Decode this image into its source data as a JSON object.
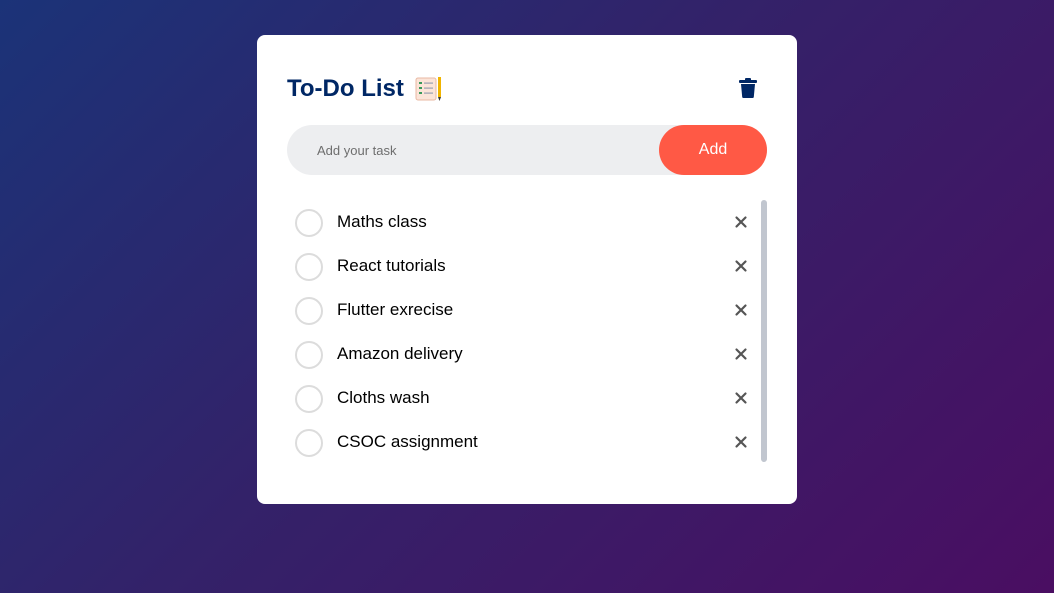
{
  "card": {
    "title": "To-Do List",
    "title_icon": "notepad-icon",
    "clear_icon": "trash-icon"
  },
  "input": {
    "placeholder": "Add your task",
    "value": "",
    "add_label": "Add"
  },
  "tasks": [
    {
      "label": "Maths class",
      "checked": false
    },
    {
      "label": "React tutorials",
      "checked": false
    },
    {
      "label": "Flutter exrecise",
      "checked": false
    },
    {
      "label": "Amazon delivery",
      "checked": false
    },
    {
      "label": "Cloths wash",
      "checked": false
    },
    {
      "label": "CSOC assignment",
      "checked": false
    }
  ],
  "colors": {
    "title": "#002765",
    "accent": "#ff5945",
    "input_bg": "#edeef0"
  }
}
